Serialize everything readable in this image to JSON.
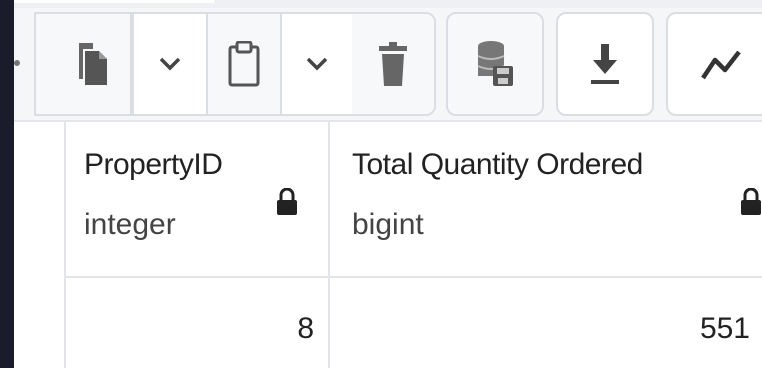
{
  "toolbar": {
    "buttons": [
      {
        "icon": "copy-icon"
      },
      {
        "icon": "chevron-down-icon"
      },
      {
        "icon": "paste-icon"
      },
      {
        "icon": "chevron-down-icon"
      },
      {
        "icon": "delete-icon"
      },
      {
        "icon": "save-data-icon"
      },
      {
        "icon": "download-icon"
      },
      {
        "icon": "graph-icon"
      }
    ]
  },
  "grid": {
    "columns": [
      {
        "name": "PropertyID",
        "type": "integer",
        "locked": true
      },
      {
        "name": "Total Quantity Ordered",
        "type": "bigint",
        "locked": true
      }
    ],
    "rows": [
      [
        "8",
        "551"
      ]
    ]
  },
  "colors": {
    "toolbar_bg": "#f5f6f8",
    "border": "#dadde2",
    "text": "#222222",
    "dark_edge": "#1b1c2b"
  }
}
